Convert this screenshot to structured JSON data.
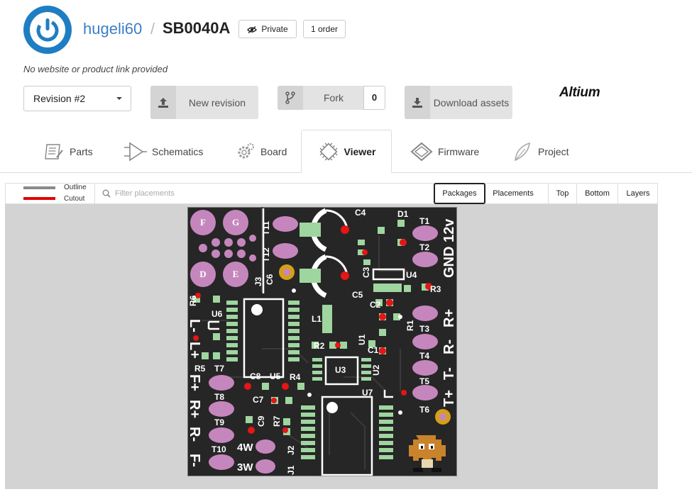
{
  "header": {
    "owner": "hugeli60",
    "separator": "/",
    "project": "SB0040A",
    "private_label": "Private",
    "orders_label": "1 order",
    "website_note": "No website or product link provided"
  },
  "actions": {
    "revision_select": "Revision #2",
    "new_revision": "New revision",
    "fork": "Fork",
    "fork_count": "0",
    "download": "Download assets",
    "tool": "Altium"
  },
  "tabs": [
    {
      "label": "Parts",
      "icon": "parts-icon"
    },
    {
      "label": "Schematics",
      "icon": "schematics-icon"
    },
    {
      "label": "Board",
      "icon": "board-icon"
    },
    {
      "label": "Viewer",
      "icon": "viewer-icon",
      "active": true
    },
    {
      "label": "Firmware",
      "icon": "firmware-icon"
    },
    {
      "label": "Project",
      "icon": "project-icon"
    }
  ],
  "viewer": {
    "legend": [
      {
        "label": "Outline",
        "color": "#8a8a8a"
      },
      {
        "label": "Cutout",
        "color": "#e00000"
      }
    ],
    "filter_placeholder": "Filter placements",
    "mode_buttons": [
      {
        "label": "Packages",
        "selected": true
      },
      {
        "label": "Placements",
        "selected": false
      }
    ],
    "side_buttons": [
      "Top",
      "Bottom",
      "Layers"
    ]
  },
  "board": {
    "designators": [
      "C4",
      "D1",
      "T1",
      "T2",
      "T11",
      "T12",
      "C6",
      "C3",
      "U4",
      "C5",
      "J3",
      "R3",
      "R6",
      "U6",
      "L1",
      "C2",
      "R1",
      "T3",
      "R2",
      "U1",
      "C1",
      "T4",
      "U3",
      "U2",
      "R5",
      "T7",
      "C8",
      "U5",
      "R4",
      "T5",
      "T8",
      "C7",
      "T6",
      "U7",
      "T9",
      "C9",
      "R7",
      "J2",
      "J1",
      "T10",
      "F",
      "G",
      "D",
      "E"
    ],
    "silk": {
      "gnd": "GND 12v",
      "r_plus_top": "R+",
      "r_minus": "R-",
      "t_minus": "T-",
      "t_plus": "T+",
      "l_minus": "L-",
      "l_plus": "L+",
      "f_plus": "F+",
      "r_plus_left": "R+",
      "r_minus_left": "R-",
      "f_minus": "F-",
      "w4": "4W",
      "w3": "3W"
    },
    "colors": {
      "board": "#262626",
      "pad_purple": "#c586bd",
      "pad_green": "#9fd59f",
      "pad_red": "#e51616",
      "pad_gold": "#d4a019",
      "silk": "#ffffff"
    }
  }
}
